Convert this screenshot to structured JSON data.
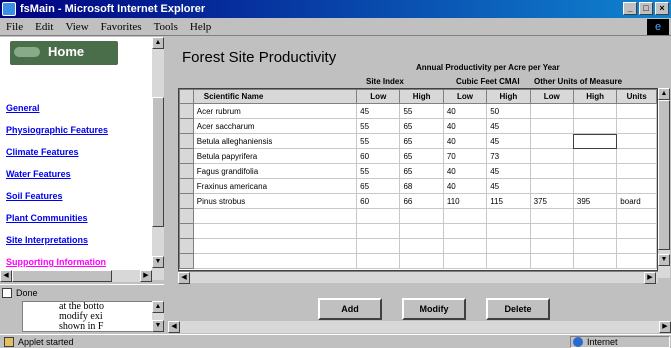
{
  "window": {
    "title": "fsMain - Microsoft Internet Explorer"
  },
  "menu": [
    "File",
    "Edit",
    "View",
    "Favorites",
    "Tools",
    "Help"
  ],
  "nav": {
    "home": "Home",
    "links": [
      "General",
      "Physiographic Features",
      "Climate Features",
      "Water Features",
      "Soil Features",
      "Plant Communities",
      "Site Interpretations",
      "Supporting Information"
    ]
  },
  "left_status": "Done",
  "text_frame": [
    "at the botto",
    "modify exi",
    "shown in F"
  ],
  "applet": {
    "title": "Forest Site Productivity",
    "annual_header": "Annual Productivity per Acre per Year",
    "group_site_index": "Site Index",
    "group_cubic": "Cubic Feet CMAI",
    "group_other": "Other Units of Measure",
    "columns": [
      "Scientific Name",
      "Low",
      "High",
      "Low",
      "High",
      "Low",
      "High",
      "Units"
    ],
    "rows": [
      [
        "Acer rubrum",
        "45",
        "55",
        "40",
        "50",
        "",
        "",
        ""
      ],
      [
        "Acer saccharum",
        "55",
        "65",
        "40",
        "45",
        "",
        "",
        ""
      ],
      [
        "Betula alleghaniensis",
        "55",
        "65",
        "40",
        "45",
        "",
        "",
        ""
      ],
      [
        "Betula papyrifera",
        "60",
        "65",
        "70",
        "73",
        "",
        "",
        ""
      ],
      [
        "Fagus grandifolia",
        "55",
        "65",
        "40",
        "45",
        "",
        "",
        ""
      ],
      [
        "Fraxinus americana",
        "65",
        "68",
        "40",
        "45",
        "",
        "",
        ""
      ],
      [
        "Pinus strobus",
        "60",
        "66",
        "110",
        "115",
        "375",
        "395",
        "board"
      ]
    ],
    "buttons": {
      "add": "Add",
      "modify": "Modify",
      "delete": "Delete"
    }
  },
  "status": {
    "left": "Applet started",
    "zone": "Internet"
  }
}
